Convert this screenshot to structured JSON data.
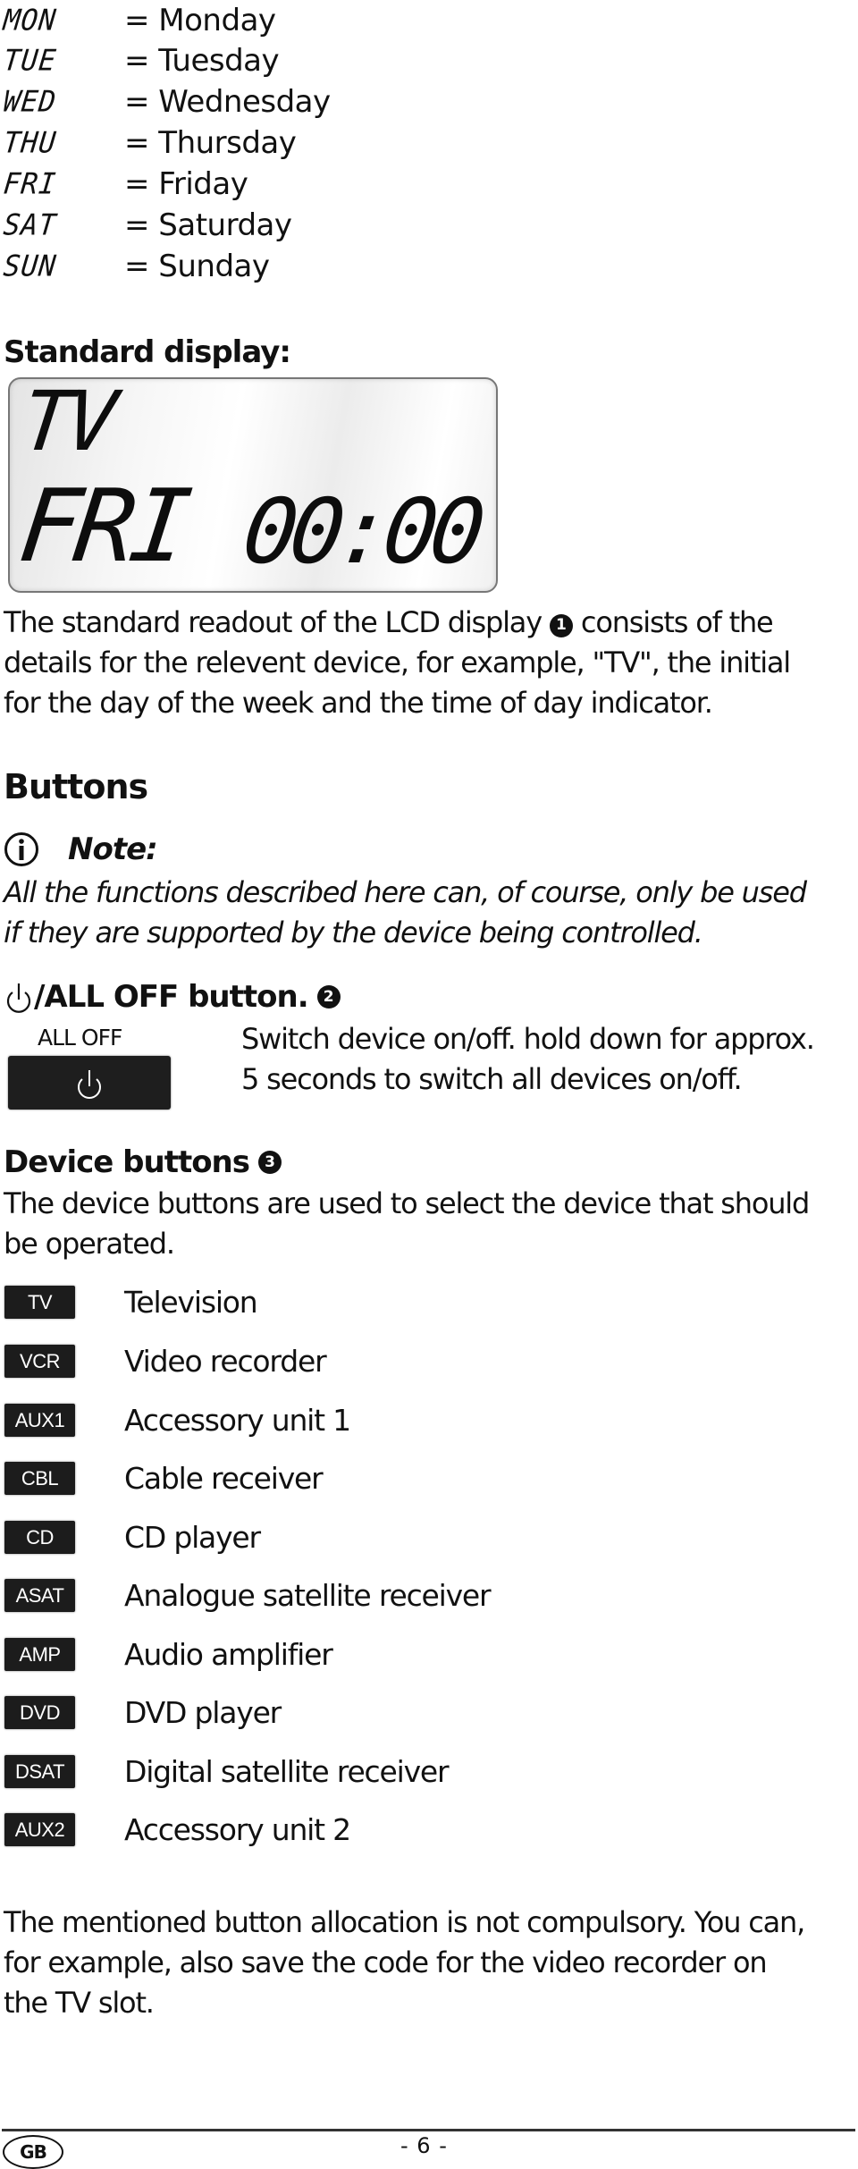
{
  "day_codes": [
    {
      "code": "MON",
      "name": "= Monday"
    },
    {
      "code": "TUE",
      "name": "= Tuesday"
    },
    {
      "code": "WED",
      "name": "= Wednesday"
    },
    {
      "code": "THU",
      "name": "= Thursday"
    },
    {
      "code": "FRI",
      "name": "= Friday"
    },
    {
      "code": "SAT",
      "name": "= Saturday"
    },
    {
      "code": "SUN",
      "name": "= Sunday"
    }
  ],
  "standard_display": {
    "heading": "Standard display:",
    "lcd": {
      "device": "TV",
      "day": "FRI",
      "time": "00:00"
    },
    "description_lines": [
      "The standard readout of the LCD display",
      "consists of the",
      "details for the relevent device, for example, \"TV\", the initial",
      "for the day of the week and the time of day indicator."
    ],
    "ref_number": "1"
  },
  "buttons": {
    "heading": "Buttons",
    "note": {
      "icon": "info-icon",
      "label": "Note:",
      "lines": [
        "All the functions described here can, of course, only be used",
        "if they are supported by the device being controlled."
      ]
    },
    "all_off": {
      "heading": "/ALL OFF button.",
      "ref_number": "2",
      "key_label": "ALL OFF",
      "key_icon": "power-icon",
      "description_lines": [
        "Switch device on/off. hold down for approx.",
        "5 seconds to switch all devices on/off."
      ]
    }
  },
  "device_buttons": {
    "heading": "Device buttons",
    "ref_number": "3",
    "intro_lines": [
      "The device buttons are used to select the device that should",
      "be operated."
    ],
    "items": [
      {
        "key": "TV",
        "description": "Television"
      },
      {
        "key": "VCR",
        "description": "Video recorder"
      },
      {
        "key": "AUX1",
        "description": "Accessory unit 1"
      },
      {
        "key": "CBL",
        "description": "Cable receiver"
      },
      {
        "key": "CD",
        "description": "CD player"
      },
      {
        "key": "ASAT",
        "description": "Analogue satellite receiver"
      },
      {
        "key": "AMP",
        "description": "Audio amplifier"
      },
      {
        "key": "DVD",
        "description": "DVD player"
      },
      {
        "key": "DSAT",
        "description": "Digital satellite receiver"
      },
      {
        "key": "AUX2",
        "description": "Accessory unit 2"
      }
    ],
    "closing_lines": [
      "The mentioned button allocation is not compulsory. You can,",
      "for example, also save the code for the video recorder on",
      "the TV slot."
    ]
  },
  "footer": {
    "language_badge": "GB",
    "page_number": "- 6 -"
  }
}
